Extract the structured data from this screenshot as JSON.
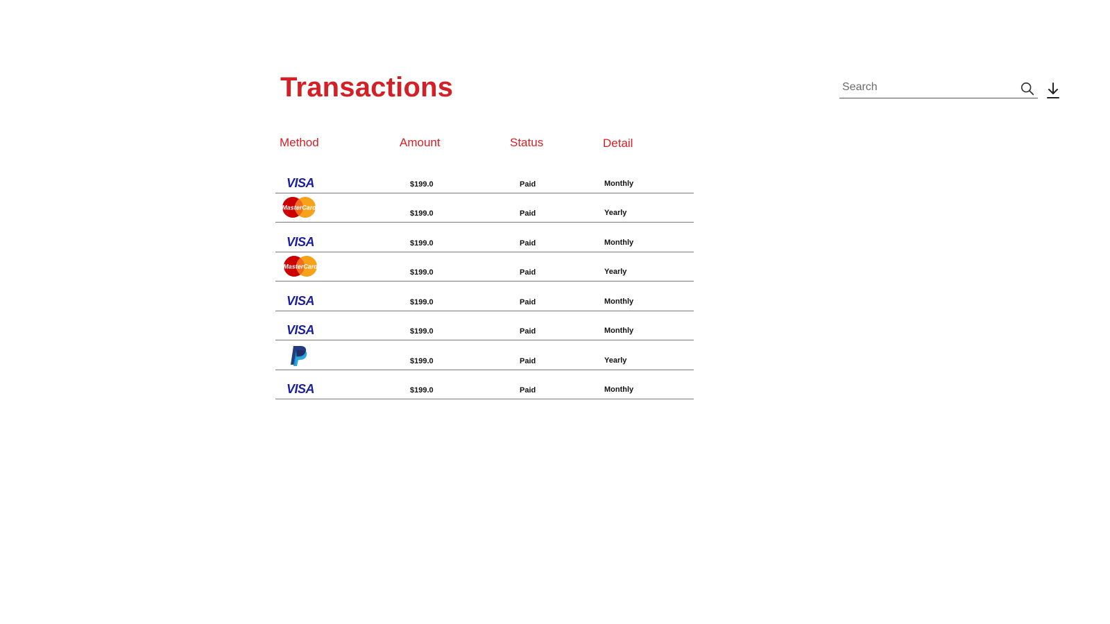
{
  "header": {
    "title": "Transactions",
    "search_placeholder": "Search",
    "search_value": ""
  },
  "colors": {
    "accent": "#d32027",
    "visa_blue": "#1a1f9c"
  },
  "table": {
    "columns": [
      "Method",
      "Amount",
      "Status",
      "Detail"
    ],
    "rows": [
      {
        "method": "VISA",
        "method_icon": "visa-logo-icon",
        "amount": "$199.0",
        "status": "Paid",
        "detail": "Monthly"
      },
      {
        "method": "MasterCard",
        "method_icon": "mastercard-logo-icon",
        "amount": "$199.0",
        "status": "Paid",
        "detail": "Yearly"
      },
      {
        "method": "VISA",
        "method_icon": "visa-logo-icon",
        "amount": "$199.0",
        "status": "Paid",
        "detail": "Monthly"
      },
      {
        "method": "MasterCard",
        "method_icon": "mastercard-logo-icon",
        "amount": "$199.0",
        "status": "Paid",
        "detail": "Yearly"
      },
      {
        "method": "VISA",
        "method_icon": "visa-logo-icon",
        "amount": "$199.0",
        "status": "Paid",
        "detail": "Monthly"
      },
      {
        "method": "VISA",
        "method_icon": "visa-logo-icon",
        "amount": "$199.0",
        "status": "Paid",
        "detail": "Monthly"
      },
      {
        "method": "PayPal",
        "method_icon": "paypal-logo-icon",
        "amount": "$199.0",
        "status": "Paid",
        "detail": "Yearly"
      },
      {
        "method": "VISA",
        "method_icon": "visa-logo-icon",
        "amount": "$199.0",
        "status": "Paid",
        "detail": "Monthly"
      }
    ]
  },
  "icons": {
    "search": "search-icon",
    "download": "download-icon"
  }
}
